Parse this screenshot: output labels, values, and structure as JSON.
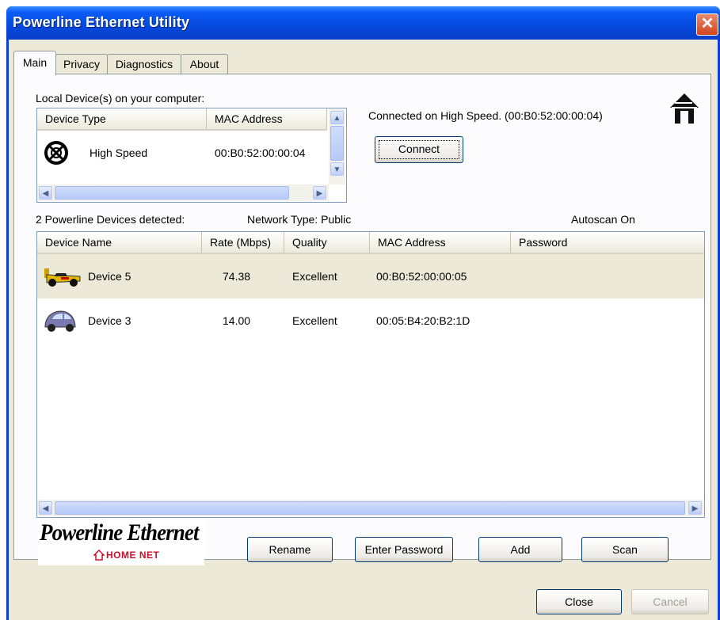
{
  "window": {
    "title": "Powerline Ethernet Utility"
  },
  "tabs": [
    {
      "label": "Main",
      "active": true
    },
    {
      "label": "Privacy",
      "active": false
    },
    {
      "label": "Diagnostics",
      "active": false
    },
    {
      "label": "About",
      "active": false
    }
  ],
  "local": {
    "section_label": "Local Device(s) on your computer:",
    "columns": [
      "Device Type",
      "MAC Address"
    ],
    "rows": [
      {
        "icon": "adapter-circle-icon",
        "type": "High Speed",
        "mac": "00:B0:52:00:00:04"
      }
    ],
    "connected_text": "Connected on  High Speed. (00:B0:52:00:00:04)",
    "connect_label": "Connect"
  },
  "status": {
    "detected": "2 Powerline Devices detected:",
    "network": "Network Type: Public",
    "autoscan": "Autoscan On"
  },
  "devices": {
    "columns": [
      "Device Name",
      "Rate (Mbps)",
      "Quality",
      "MAC Address",
      "Password"
    ],
    "rows": [
      {
        "icon": "race-car-icon",
        "name": "Device 5",
        "rate": "74.38",
        "quality": "Excellent",
        "mac": "00:B0:52:00:00:05",
        "password": "",
        "selected": true
      },
      {
        "icon": "beetle-car-icon",
        "name": "Device 3",
        "rate": "14.00",
        "quality": "Excellent",
        "mac": "00:05:B4:20:B2:1D",
        "password": "",
        "selected": false
      }
    ]
  },
  "logo": {
    "main": "Powerline Ethernet",
    "sub": "HOME NET"
  },
  "buttons": {
    "rename": "Rename",
    "enter_password": "Enter Password",
    "add": "Add",
    "scan": "Scan",
    "close": "Close",
    "cancel": "Cancel"
  },
  "colors": {
    "selected_row": "#ece9d8",
    "title_bar": "#0a5cf5",
    "face": "#ece9d8"
  }
}
